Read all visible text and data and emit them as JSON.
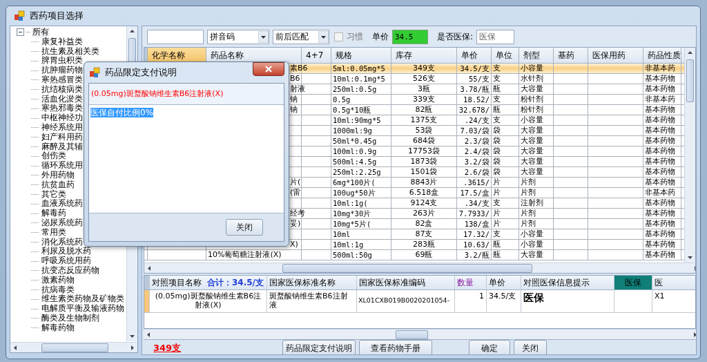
{
  "window": {
    "title": "西药项目选择"
  },
  "tree": {
    "label": "所有",
    "expanded": true,
    "selected": true,
    "children": [
      {
        "label": "康复补益类",
        "selected": false
      },
      {
        "label": "抗生素及相关类",
        "selected": false
      },
      {
        "label": "脾胃虫积类",
        "selected": false
      },
      {
        "label": "抗肿瘤药物",
        "selected": false
      },
      {
        "label": "寒热感冒类",
        "selected": false
      },
      {
        "label": "抗结核病类",
        "selected": false
      },
      {
        "label": "活血化淤类",
        "selected": false
      },
      {
        "label": "寒热邪毒类",
        "selected": false
      },
      {
        "label": "中枢神经功",
        "selected": false
      },
      {
        "label": "神经系统用",
        "selected": false
      },
      {
        "label": "妇产科用药",
        "selected": false
      },
      {
        "label": "麻醉及其辅",
        "selected": false
      },
      {
        "label": "创伤类",
        "selected": false
      },
      {
        "label": "循环系统用",
        "selected": false
      },
      {
        "label": "外用药物",
        "selected": false
      },
      {
        "label": "抗贫血药",
        "selected": false
      },
      {
        "label": "其它类",
        "selected": false
      },
      {
        "label": "血液系统药",
        "selected": false
      },
      {
        "label": "解毒药",
        "selected": false
      },
      {
        "label": "泌尿系统药",
        "selected": false
      },
      {
        "label": "常用类",
        "selected": false
      },
      {
        "label": "消化系统药",
        "selected": false
      },
      {
        "label": "利尿及脱水药",
        "selected": false
      },
      {
        "label": "呼吸系统用药",
        "selected": false
      },
      {
        "label": "抗变态反应药物",
        "selected": false
      },
      {
        "label": "激素药物",
        "selected": false
      },
      {
        "label": "抗病毒类",
        "selected": false
      },
      {
        "label": "维生素类药物及矿物类",
        "selected": false
      },
      {
        "label": "电解质平衡及输液药物",
        "selected": false
      },
      {
        "label": "酶类及生物制剂",
        "selected": false
      },
      {
        "label": "解毒药物",
        "selected": false
      }
    ]
  },
  "toolbar": {
    "search_mode": "拼音码",
    "match_mode": "前后匹配",
    "habit": {
      "label": "习惯",
      "checked": false
    },
    "price_label": "单价",
    "price_value": "34.5",
    "insurance_label": "是否医保:",
    "insurance_value": "医保"
  },
  "table": {
    "columns": [
      "化学名称",
      "药品名称",
      "4+7",
      "规格",
      "库存",
      "单价",
      "单位",
      "剂型",
      "基药",
      "医保用药",
      "药品性质"
    ],
    "rows": [
      {
        "selected": true,
        "cells": [
          "",
          "素B6",
          "",
          "5ml:0.05mg*5",
          "349支",
          "34.5/支",
          "支",
          "小容量",
          "",
          "",
          "非基本药"
        ]
      },
      {
        "selected": false,
        "cells": [
          "",
          "B6",
          "",
          "10ml:0.1mg*5",
          "526支",
          "55/支",
          "支",
          "水针剂",
          "",
          "",
          "基本药物"
        ]
      },
      {
        "selected": false,
        "cells": [
          "",
          "射液",
          "",
          "250ml:0.5g",
          "3瓶",
          "3.78/瓶",
          "瓶",
          "大容量",
          "",
          "",
          "基本药物"
        ]
      },
      {
        "selected": false,
        "cells": [
          "",
          "钠",
          "",
          "0.5g",
          "339支",
          "18.52/",
          "支",
          "粉针剂",
          "",
          "",
          "非基本药"
        ]
      },
      {
        "selected": false,
        "cells": [
          "",
          "钠",
          "",
          "0.5g*10瓶",
          "82瓶",
          "32.678/",
          "瓶",
          "粉针剂",
          "",
          "",
          "基本药物"
        ]
      },
      {
        "selected": false,
        "cells": [
          "",
          "",
          "",
          "10ml:90mg*5",
          "1375支",
          ".24/支",
          "支",
          "小容量",
          "",
          "",
          "基本药物"
        ]
      },
      {
        "selected": false,
        "cells": [
          "",
          "",
          "",
          "1000ml:9g",
          "53袋",
          "7.03/袋",
          "袋",
          "大容量",
          "",
          "",
          "基本药物"
        ]
      },
      {
        "selected": false,
        "cells": [
          "",
          "",
          "",
          "50ml*0.45g",
          "684袋",
          "2.3/袋",
          "袋",
          "大容量",
          "",
          "",
          "基本药物"
        ]
      },
      {
        "selected": false,
        "cells": [
          "",
          "",
          "",
          "100ml:0.9g",
          "17753袋",
          "2.4/袋",
          "袋",
          "大容量",
          "",
          "",
          "基本药物"
        ]
      },
      {
        "selected": false,
        "cells": [
          "",
          "",
          "",
          "500ml:4.5g",
          "1873袋",
          "3.2/袋",
          "袋",
          "大容量",
          "",
          "",
          "基本药物"
        ]
      },
      {
        "selected": false,
        "cells": [
          "",
          "",
          "",
          "250ml:2.25g",
          "1501袋",
          "2.6/袋",
          "袋",
          "大容量",
          "",
          "",
          "基本药物"
        ]
      },
      {
        "selected": false,
        "cells": [
          "",
          "片(",
          "",
          "6mg*100片(",
          "8843片",
          ".3615/",
          "片",
          "片剂",
          "",
          "",
          "基本药物"
        ]
      },
      {
        "selected": false,
        "cells": [
          "",
          "(雷",
          "",
          "100ug*50片",
          "6.518盒",
          "17.5/盒",
          "片",
          "片剂",
          "",
          "",
          "非基本药"
        ]
      },
      {
        "selected": false,
        "cells": [
          "",
          "",
          "",
          "10ml:1g(",
          "9124支",
          ".34/支",
          "支",
          "注射剂",
          "",
          "",
          "基本药物"
        ]
      },
      {
        "selected": false,
        "cells": [
          "",
          "经考",
          "",
          "10mg*30片",
          "263片",
          "7.7933/",
          "片",
          "片剂",
          "",
          "",
          "基本药物"
        ]
      },
      {
        "selected": false,
        "cells": [
          "",
          "妥)",
          "",
          "10mg*5片(",
          "82盒",
          "138/盒",
          "片",
          "片剂",
          "",
          "",
          "基本药物"
        ]
      },
      {
        "selected": false,
        "cells": [
          "",
          "",
          "",
          "10ml",
          "87支",
          "17.32/",
          "支",
          "小容量",
          "",
          "",
          "基本药物"
        ]
      },
      {
        "selected": false,
        "cells": [
          "",
          "X)",
          "",
          "10ml:1g",
          "283瓶",
          "10.63/",
          "瓶",
          "小容量",
          "",
          "",
          "基本药物"
        ]
      },
      {
        "selected": false,
        "cells": [
          "",
          "10%葡萄糖注射液(X)",
          "",
          "500ml:50g",
          "69瓶",
          "3.2/瓶",
          "瓶",
          "大容量",
          "",
          "",
          "基本药物"
        ]
      }
    ]
  },
  "detail": {
    "columns": [
      "对照项目名称",
      "国家医保标准名称",
      "国家医保标准编码",
      "数量",
      "单价",
      "对照医保信息提示",
      "医保",
      "医"
    ],
    "total": "合计：34.5/支",
    "rows": [
      {
        "selected": true,
        "cells": [
          "(0.05mg)斑蝥酸钠维生素B6注射液(X)",
          "斑蝥酸钠维生素B6注射液",
          "XL01CXB019B0020201054-",
          "1",
          "34.5/支",
          "医保",
          "",
          "X1"
        ]
      }
    ]
  },
  "footer": {
    "stock": "349支",
    "buttons": [
      "药品限定支付说明",
      "查看药物手册",
      "确定",
      "关闭"
    ]
  },
  "dialog": {
    "title": "药品限定支付说明",
    "drug": "(0.05mg)斑蝥酸钠维生素B6注射液(X)",
    "note": "医保自付比例0%",
    "note_selected": true,
    "button": "关闭"
  }
}
